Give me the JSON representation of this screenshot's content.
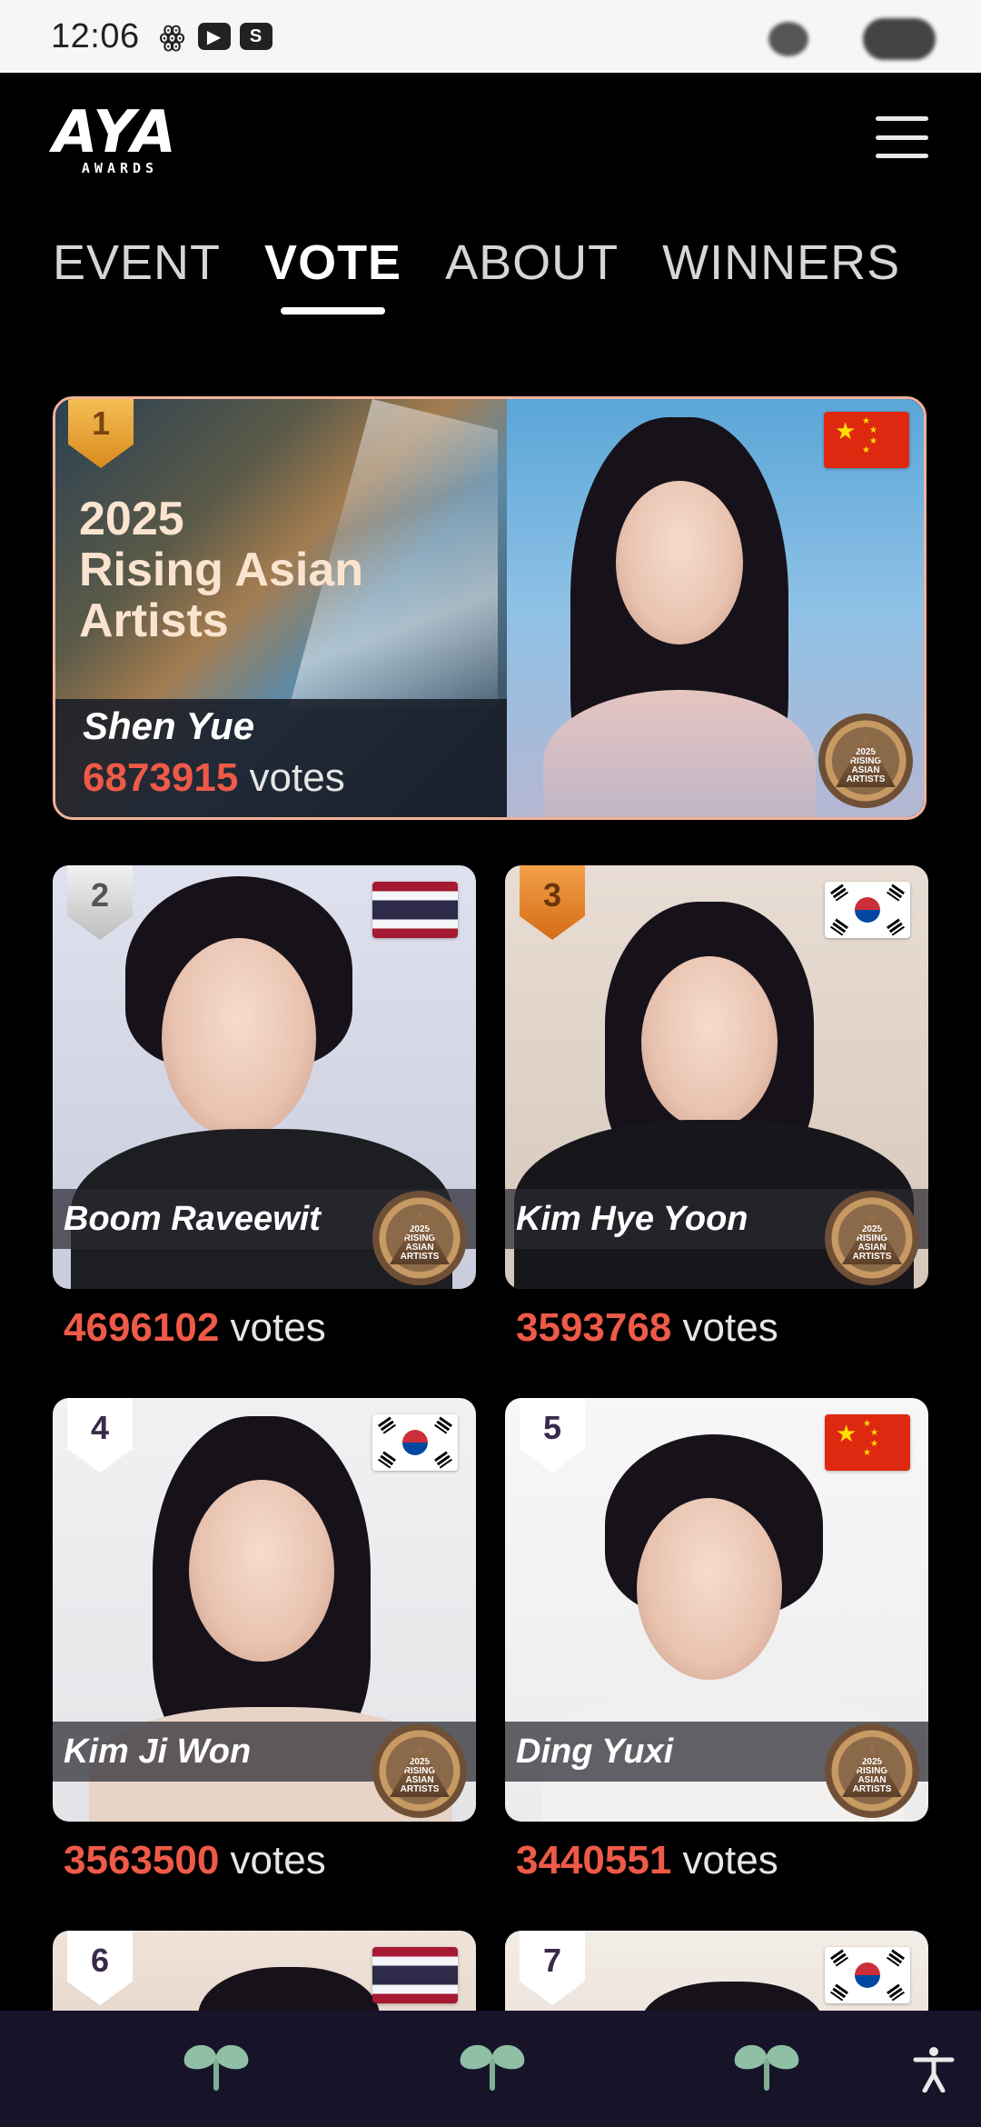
{
  "status_bar": {
    "time": "12:06",
    "icons": [
      "weibo-icon",
      "youtube-icon",
      "s-app-icon"
    ],
    "s_app_letter": "S"
  },
  "header": {
    "logo_text": "AYA",
    "logo_subtext": "AWARDS",
    "menu_icon": "hamburger-icon"
  },
  "tabs": [
    {
      "label": "EVENT",
      "active": false
    },
    {
      "label": "VOTE",
      "active": true
    },
    {
      "label": "ABOUT",
      "active": false
    },
    {
      "label": "WINNERS",
      "active": false
    }
  ],
  "featured": {
    "rank": "1",
    "title_line1": "2025",
    "title_line2": "Rising Asian",
    "title_line3": "Artists",
    "name": "Shen Yue",
    "votes": "6873915",
    "votes_word": "votes",
    "flag": "china"
  },
  "seal_text": "2025\nRISING\nASIAN\nARTISTS",
  "candidates": [
    {
      "rank": "2",
      "name": "Boom Raveewit",
      "votes": "4696102",
      "votes_word": "votes",
      "flag": "thailand"
    },
    {
      "rank": "3",
      "name": "Kim Hye Yoon",
      "votes": "3593768",
      "votes_word": "votes",
      "flag": "south-korea"
    },
    {
      "rank": "4",
      "name": "Kim Ji Won",
      "votes": "3563500",
      "votes_word": "votes",
      "flag": "south-korea"
    },
    {
      "rank": "5",
      "name": "Ding Yuxi",
      "votes": "3440551",
      "votes_word": "votes",
      "flag": "china"
    },
    {
      "rank": "6",
      "flag": "thailand"
    },
    {
      "rank": "7",
      "flag": "south-korea"
    }
  ],
  "bottom_nav": {
    "items": [
      "sprout-icon",
      "sprout-icon",
      "sprout-icon"
    ],
    "accessibility_icon": "accessibility-icon"
  },
  "colors": {
    "votes_accent": "#ef5a48",
    "featured_border": "#f2b29a",
    "nav_background": "#17142a"
  }
}
